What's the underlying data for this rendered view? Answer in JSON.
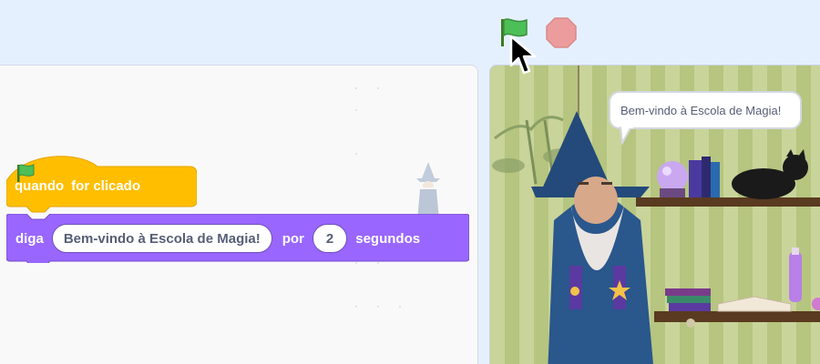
{
  "code_area": {
    "hat_block": {
      "text_before": "quando",
      "flag_icon": "green-flag-icon",
      "text_after": "for clicado",
      "color": "#ffbf00"
    },
    "say_block": {
      "verb": "diga",
      "message": "Bem-vindo à Escola de Magia!",
      "por": "por",
      "seconds": "2",
      "unit": "segundos",
      "color": "#9966ff"
    }
  },
  "controls": {
    "green_flag": "green-flag-icon",
    "stop": "stop-icon"
  },
  "stage": {
    "speech_text": "Bem-vindo à Escola de Magia!"
  }
}
